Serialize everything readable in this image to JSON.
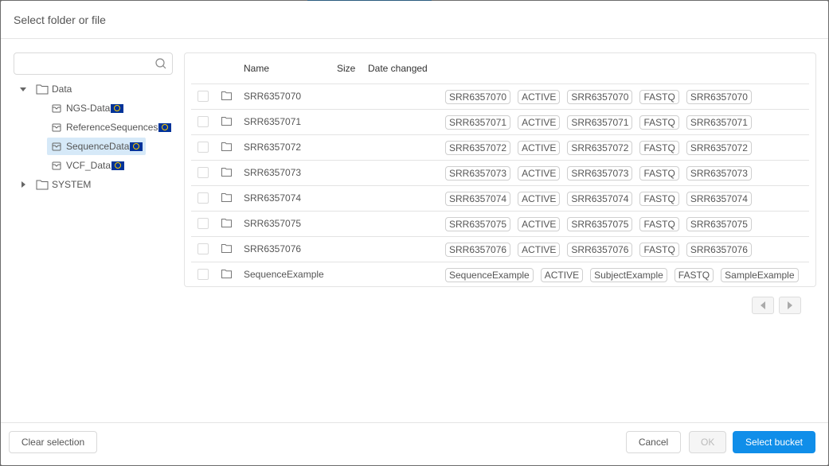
{
  "modal": {
    "title": "Select folder or file"
  },
  "search": {
    "placeholder": "",
    "value": ""
  },
  "tree": {
    "root": {
      "label": "Data",
      "expanded": true
    },
    "children": [
      {
        "label": "NGS-Data",
        "icon": "bucket-icon",
        "badge": "eu-flag-icon",
        "selected": false
      },
      {
        "label": "ReferenceSequences",
        "icon": "bucket-icon",
        "badge": "eu-flag-icon",
        "selected": false
      },
      {
        "label": "SequenceData",
        "icon": "bucket-icon",
        "badge": "eu-flag-icon",
        "selected": true
      },
      {
        "label": "VCF_Data",
        "icon": "bucket-icon",
        "badge": "eu-flag-icon",
        "selected": false
      }
    ],
    "system": {
      "label": "SYSTEM",
      "expanded": false
    }
  },
  "table": {
    "headers": {
      "name": "Name",
      "size": "Size",
      "date": "Date changed"
    },
    "rows": [
      {
        "name": "SRR6357070",
        "tags": [
          "SRR6357070",
          "ACTIVE",
          "SRR6357070",
          "FASTQ",
          "SRR6357070"
        ]
      },
      {
        "name": "SRR6357071",
        "tags": [
          "SRR6357071",
          "ACTIVE",
          "SRR6357071",
          "FASTQ",
          "SRR6357071"
        ]
      },
      {
        "name": "SRR6357072",
        "tags": [
          "SRR6357072",
          "ACTIVE",
          "SRR6357072",
          "FASTQ",
          "SRR6357072"
        ]
      },
      {
        "name": "SRR6357073",
        "tags": [
          "SRR6357073",
          "ACTIVE",
          "SRR6357073",
          "FASTQ",
          "SRR6357073"
        ]
      },
      {
        "name": "SRR6357074",
        "tags": [
          "SRR6357074",
          "ACTIVE",
          "SRR6357074",
          "FASTQ",
          "SRR6357074"
        ]
      },
      {
        "name": "SRR6357075",
        "tags": [
          "SRR6357075",
          "ACTIVE",
          "SRR6357075",
          "FASTQ",
          "SRR6357075"
        ]
      },
      {
        "name": "SRR6357076",
        "tags": [
          "SRR6357076",
          "ACTIVE",
          "SRR6357076",
          "FASTQ",
          "SRR6357076"
        ]
      },
      {
        "name": "SequenceExample",
        "tags": [
          "SequenceExample",
          "ACTIVE",
          "SubjectExample",
          "FASTQ",
          "SampleExample"
        ]
      }
    ]
  },
  "pagination": {
    "prev_icon": "caret-left-icon",
    "next_icon": "caret-right-icon"
  },
  "footer": {
    "clear_label": "Clear selection",
    "cancel_label": "Cancel",
    "ok_label": "OK",
    "select_label": "Select bucket"
  },
  "colors": {
    "primary": "#108ee9",
    "selected_bg": "#d6e9f8",
    "flag_blue": "#003399",
    "flag_yellow": "#ffcc00"
  }
}
